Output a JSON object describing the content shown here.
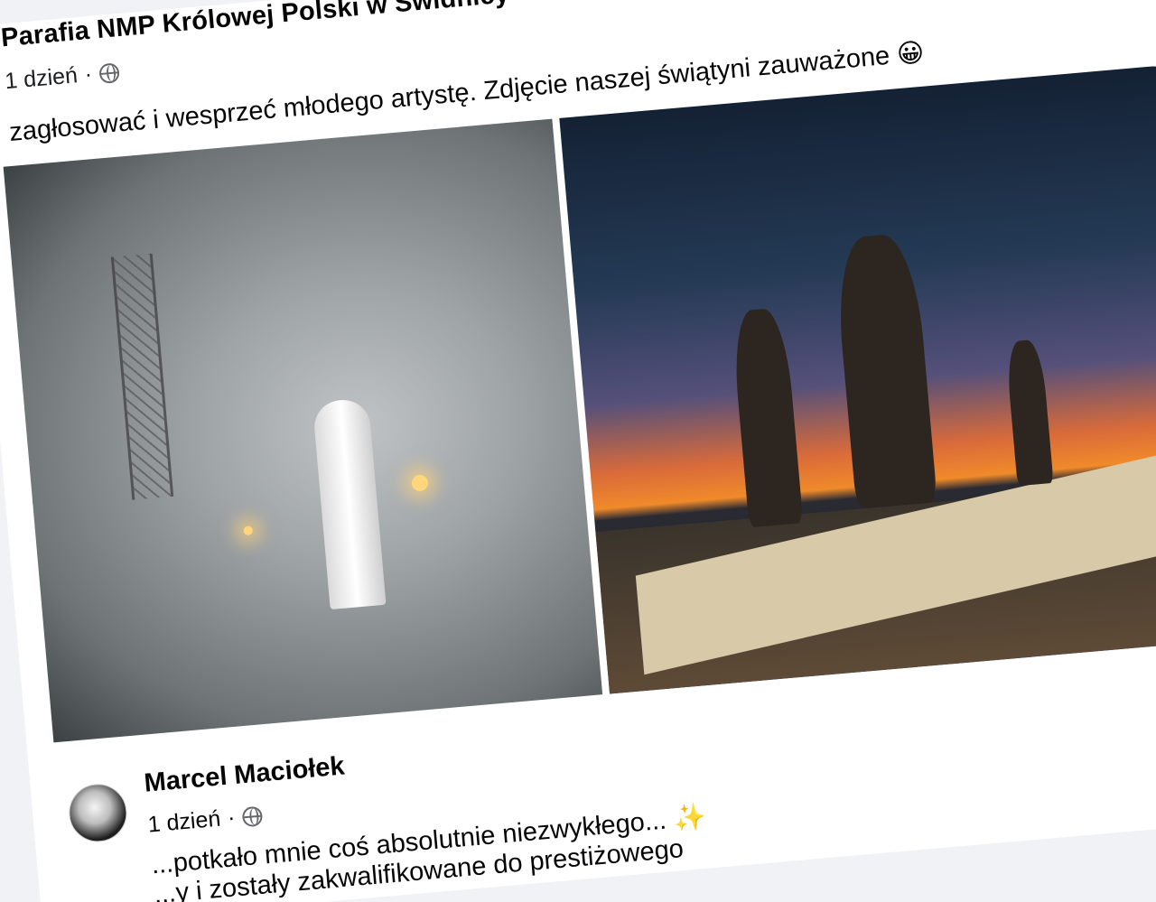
{
  "post": {
    "author": "Parafia NMP Królowej Polski w Świdnicy",
    "time": "1 dzień",
    "separator": "·",
    "text": "zagłosować i wesprzeć młodego artystę. Zdjęcie naszej świątyni zauważone 😀",
    "photos": [
      {
        "subject": "fog-tower-photo"
      },
      {
        "subject": "sunset-angel-statues-photo"
      }
    ]
  },
  "comment": {
    "author": "Marcel Maciołek",
    "time": "1 dzień",
    "separator": "·",
    "text_line1": "...potkało mnie coś absolutnie niezwykłego... ✨",
    "text_line2": "...y i zostały zakwalifikowane do prestiżowego"
  },
  "icons": {
    "privacy": "globe-icon"
  }
}
